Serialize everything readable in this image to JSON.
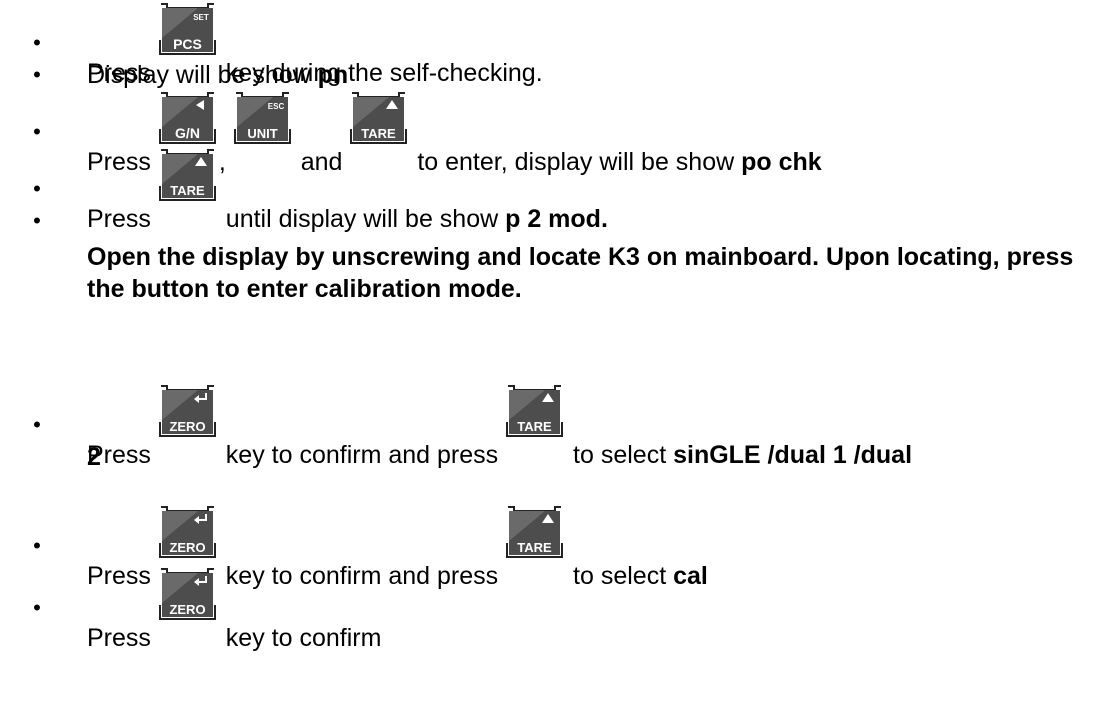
{
  "steps": [
    {
      "pre": "Press ",
      "key": "PCS",
      "sub": "SET",
      "post": " key during the self-checking."
    },
    {
      "text": "Display will be show ",
      "bold": "pn"
    },
    {
      "pre": "Press ",
      "key1": "G/N",
      "sep1": ", ",
      "key2": "UNIT",
      "key2sub": "ESC",
      "sep2": " and ",
      "key3": "TARE",
      "post": " to enter, display will be show ",
      "bold": "po chk"
    },
    {
      "pre": "Press ",
      "key": "TARE",
      "post": " until display will be show ",
      "bold": "p 2 mod."
    },
    {
      "bold": "Open the display by unscrewing and locate K3 on mainboard. Upon locating, press the button to enter calibration mode."
    },
    {
      "pre": "Press ",
      "key1": "ZERO",
      "mid": " key to confirm and press ",
      "key2": "TARE",
      "post": " to select ",
      "bold": "sinGLE /dual 1 /dual",
      "bold2": "2"
    },
    {
      "pre": "Press ",
      "key1": "ZERO",
      "mid": " key to confirm and press ",
      "key2": "TARE",
      "post": " to select ",
      "bold": "cal"
    },
    {
      "pre": "Press ",
      "key": "ZERO",
      "post": " key to confirm"
    }
  ],
  "bullet": "•",
  "colors": {
    "key_dark": "#4d4d4d",
    "key_label": "#ffffff",
    "text": "#000000"
  }
}
